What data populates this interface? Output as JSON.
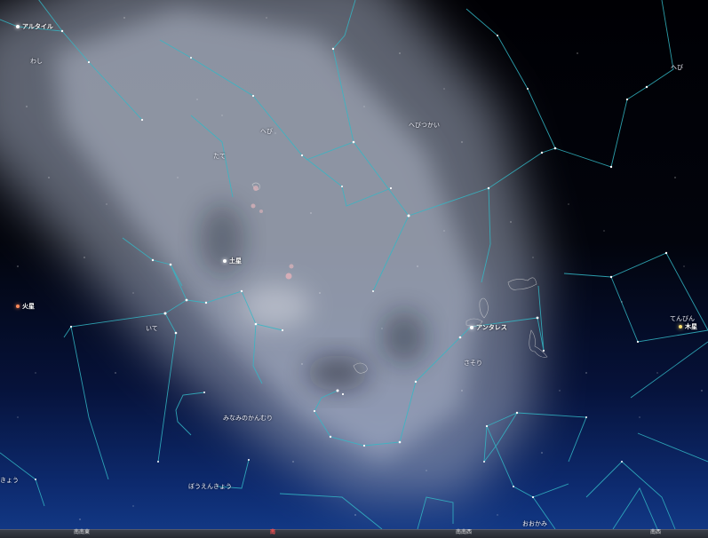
{
  "constellations": {
    "washi": "わし",
    "hebi_upper": "へび",
    "hebi_right": "へび",
    "hebitsukai": "へびつかい",
    "tate": "たて",
    "ite": "いて",
    "sasori": "さそり",
    "minaminokanmuri": "みなみのかんむり",
    "bouenkyou": "ぼうえんきょう",
    "kenbikyou_partial": "きょう",
    "tenbin": "てんびん",
    "ookami": "おおかみ"
  },
  "planets": {
    "altair": {
      "label": "アルタイル",
      "color": "#ffffff"
    },
    "saturn": {
      "label": "土星",
      "color": "#ffffff"
    },
    "mars": {
      "label": "火星",
      "color": "#ff8a5a"
    },
    "antares": {
      "label": "アンタレス",
      "color": "#ffffff"
    },
    "jupiter": {
      "label": "木星",
      "color": "#ffe070"
    }
  },
  "horizon": {
    "sse": "南南東",
    "south": "南",
    "ssw": "南南西",
    "sw": "南西"
  },
  "colors": {
    "constellation_line": "#33b8c6",
    "milky_way": "#c8d2e6"
  }
}
